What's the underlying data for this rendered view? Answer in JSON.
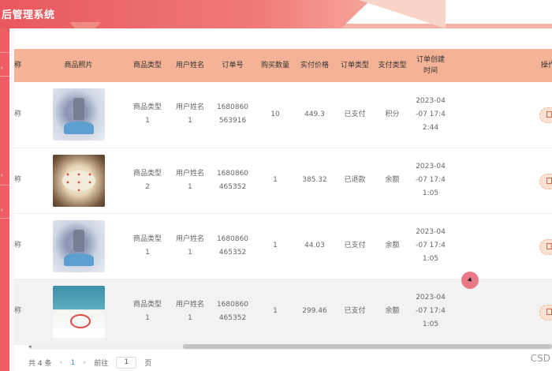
{
  "app": {
    "title": "后管理系统"
  },
  "table": {
    "headers": [
      "称",
      "商品照片",
      "商品类型",
      "用户姓名",
      "订单号",
      "购买数量",
      "实付价格",
      "订单类型",
      "支付类型",
      "订单创建时间",
      "操作"
    ],
    "rows": [
      {
        "name_partial": "称",
        "photo": "cake-photo-1",
        "type": "商品类型1",
        "user": "用户姓名1",
        "order_no": "1680860563916",
        "qty": "10",
        "price": "449.3",
        "order_type": "已支付",
        "pay_type": "积分",
        "created": "2023-04-07 17:42:44",
        "action": "详"
      },
      {
        "name_partial": "称",
        "photo": "cake-photo-2",
        "type": "商品类型2",
        "user": "用户姓名1",
        "order_no": "1680860465352",
        "qty": "1",
        "price": "385.32",
        "order_type": "已退款",
        "pay_type": "余额",
        "created": "2023-04-07 17:41:05",
        "action": "详"
      },
      {
        "name_partial": "称",
        "photo": "cake-photo-1",
        "type": "商品类型1",
        "user": "用户姓名1",
        "order_no": "1680860465352",
        "qty": "1",
        "price": "44.03",
        "order_type": "已支付",
        "pay_type": "余额",
        "created": "2023-04-07 17:41:05",
        "action": "详"
      },
      {
        "name_partial": "称",
        "photo": "cake-photo-3",
        "type": "商品类型1",
        "user": "用户姓名1",
        "order_no": "1680860465352",
        "qty": "1",
        "price": "299.46",
        "order_type": "已支付",
        "pay_type": "余额",
        "created": "2023-04-07 17:41:05",
        "action": "详"
      }
    ]
  },
  "pagination": {
    "total": "共 4 条",
    "prev": "‹",
    "current": "1",
    "next": "›",
    "goto": "前往",
    "page_value": "1",
    "page_suffix": "页"
  },
  "watermark": "CSD",
  "colors": {
    "header": "#f4b396",
    "banner": "#e8585e",
    "sidebar": "#ef5e63"
  }
}
